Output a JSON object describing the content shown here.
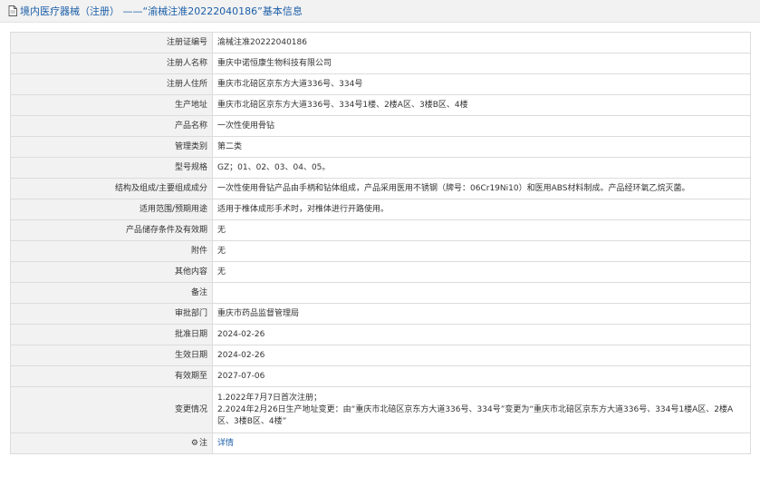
{
  "header": {
    "icon": "document-icon",
    "title": "境内医疗器械（注册） ——“渝械注准20222040186”基本信息"
  },
  "rows": [
    {
      "label": "注册证编号",
      "value": "渝械注准20222040186"
    },
    {
      "label": "注册人名称",
      "value": "重庆中诺恒康生物科技有限公司"
    },
    {
      "label": "注册人住所",
      "value": "重庆市北碚区京东方大道336号、334号"
    },
    {
      "label": "生产地址",
      "value": "重庆市北碚区京东方大道336号、334号1楼、2楼A区、3楼B区、4楼"
    },
    {
      "label": "产品名称",
      "value": "一次性使用骨钻"
    },
    {
      "label": "管理类别",
      "value": "第二类"
    },
    {
      "label": "型号规格",
      "value": "GZ；01、02、03、04、05。"
    },
    {
      "label": "结构及组成/主要组成成分",
      "value": "一次性使用骨钻产品由手柄和钻体组成，产品采用医用不锈钢（牌号：06Cr19Ni10）和医用ABS材料制成。产品经环氧乙烷灭菌。"
    },
    {
      "label": "适用范围/预期用途",
      "value": "适用于椎体成形手术时，对椎体进行开路使用。"
    },
    {
      "label": "产品储存条件及有效期",
      "value": "无"
    },
    {
      "label": "附件",
      "value": "无"
    },
    {
      "label": "其他内容",
      "value": "无"
    },
    {
      "label": "备注",
      "value": ""
    },
    {
      "label": "审批部门",
      "value": "重庆市药品监督管理局"
    },
    {
      "label": "批准日期",
      "value": "2024-02-26"
    },
    {
      "label": "生效日期",
      "value": "2024-02-26"
    },
    {
      "label": "有效期至",
      "value": "2027-07-06"
    }
  ],
  "change_row": {
    "label": "变更情况",
    "lines": [
      "1.2022年7月7日首次注册；",
      "2.2024年2月26日生产地址变更：由“重庆市北碚区京东方大道336号、334号”变更为“重庆市北碚区京东方大道336号、334号1楼A区、2楼A区、3楼B区、4楼”"
    ]
  },
  "note_row": {
    "icon": "gear-icon",
    "label": "注",
    "link_text": "详情"
  }
}
